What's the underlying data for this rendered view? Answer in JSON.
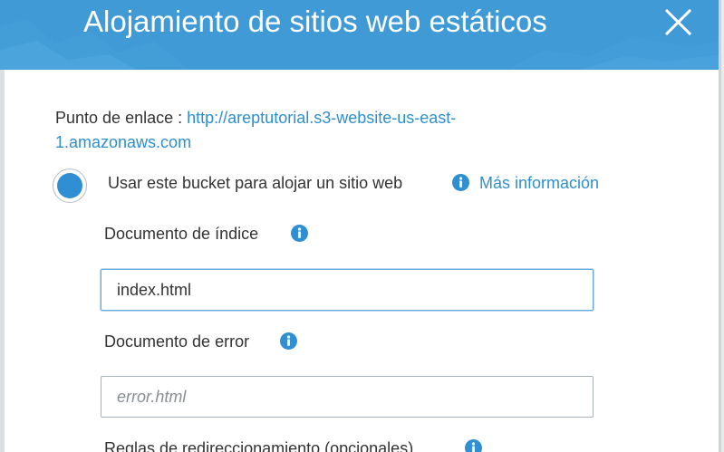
{
  "modal": {
    "title": "Alojamiento de sitios web estáticos",
    "close_icon": "close-icon",
    "header_color": "#3f9ad5"
  },
  "endpoint": {
    "label": "Punto de enlace :",
    "url": "http://areptutorial.s3-website-us-east-1.amazonaws.com"
  },
  "hosting_option": {
    "label": "Usar este bucket para alojar un sitio web",
    "selected": true,
    "more_info": "Más información",
    "info_icon": "info-icon"
  },
  "index_document": {
    "label": "Documento de índice",
    "value": "index.html",
    "info_icon": "info-icon"
  },
  "error_document": {
    "label": "Documento de error",
    "value": "",
    "placeholder": "error.html",
    "info_icon": "info-icon"
  },
  "redirect_rules": {
    "label": "Reglas de redireccionamiento (opcionales)",
    "info_icon": "info-icon"
  },
  "colors": {
    "accent": "#2f8fd2",
    "link": "#2e8fcc",
    "info_icon": "#2f8fd2"
  }
}
